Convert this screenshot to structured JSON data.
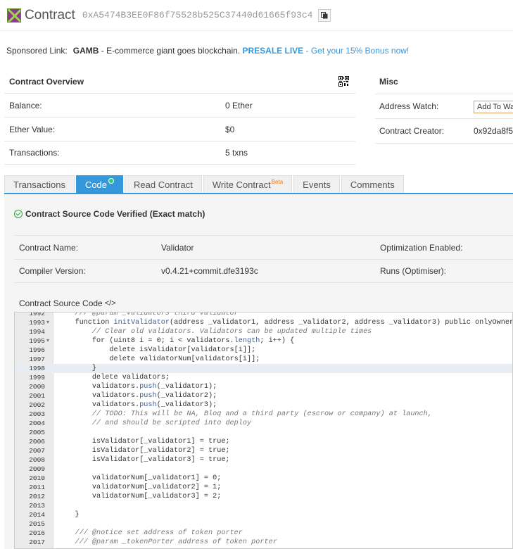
{
  "header": {
    "title": "Contract",
    "address": "0xA5474B3EE0F86f75528b525C37440d61665f93c4"
  },
  "sponsor": {
    "label": "Sponsored Link:",
    "brand": "GAMB",
    "text": " - E-commerce giant goes blockchain. ",
    "presale": "PRESALE LIVE",
    "bonus": " - Get your 15% Bonus now!"
  },
  "overview": {
    "title": "Contract Overview",
    "rows": [
      {
        "key": "Balance:",
        "value": "0 Ether"
      },
      {
        "key": "Ether Value:",
        "value": "$0"
      },
      {
        "key": "Transactions:",
        "value": "5 txns"
      }
    ]
  },
  "misc": {
    "title": "Misc",
    "watch_label": "Address Watch:",
    "watch_button": "Add To Watch",
    "creator_label": "Contract Creator:",
    "creator_value": "0x92da8f5"
  },
  "tabs": [
    {
      "label": "Transactions"
    },
    {
      "label": "Code"
    },
    {
      "label": "Read Contract"
    },
    {
      "label": "Write Contract",
      "sup": "Beta"
    },
    {
      "label": "Events"
    },
    {
      "label": "Comments"
    }
  ],
  "code_section": {
    "verified": "Contract Source Code Verified (Exact match)",
    "contract_name_label": "Contract Name:",
    "contract_name": "Validator",
    "compiler_label": "Compiler Version:",
    "compiler": "v0.4.21+commit.dfe3193c",
    "optimization_label": "Optimization Enabled:",
    "runs_label": "Runs (Optimiser):",
    "source_title": "Contract Source Code",
    "source_tag": "</>"
  },
  "code_lines": [
    {
      "n": "1992",
      "t": "    /// @param _validators third validator"
    },
    {
      "n": "1993",
      "t": "    function initValidator(address _validator1, address _validator2, address _validator3) public onlyOwner {",
      "fold": true
    },
    {
      "n": "1994",
      "t": "        // Clear old validators. Validators can be updated multiple times"
    },
    {
      "n": "1995",
      "t": "        for (uint8 i = 0; i < validators.length; i++) {",
      "fold": true
    },
    {
      "n": "1996",
      "t": "            delete isValidator[validators[i]];"
    },
    {
      "n": "1997",
      "t": "            delete validatorNum[validators[i]];"
    },
    {
      "n": "1998",
      "t": "        }",
      "hl": true
    },
    {
      "n": "1999",
      "t": "        delete validators;"
    },
    {
      "n": "2000",
      "t": "        validators.push(_validator1);"
    },
    {
      "n": "2001",
      "t": "        validators.push(_validator2);"
    },
    {
      "n": "2002",
      "t": "        validators.push(_validator3);"
    },
    {
      "n": "2003",
      "t": "        // TODO: This will be NA, Bloq and a third party (escrow or company) at launch,"
    },
    {
      "n": "2004",
      "t": "        // and should be scripted into deploy"
    },
    {
      "n": "2005",
      "t": ""
    },
    {
      "n": "2006",
      "t": "        isValidator[_validator1] = true;"
    },
    {
      "n": "2007",
      "t": "        isValidator[_validator2] = true;"
    },
    {
      "n": "2008",
      "t": "        isValidator[_validator3] = true;"
    },
    {
      "n": "2009",
      "t": ""
    },
    {
      "n": "2010",
      "t": "        validatorNum[_validator1] = 0;"
    },
    {
      "n": "2011",
      "t": "        validatorNum[_validator2] = 1;"
    },
    {
      "n": "2012",
      "t": "        validatorNum[_validator3] = 2;"
    },
    {
      "n": "2013",
      "t": ""
    },
    {
      "n": "2014",
      "t": "    }"
    },
    {
      "n": "2015",
      "t": ""
    },
    {
      "n": "2016",
      "t": "    /// @notice set address of token porter"
    },
    {
      "n": "2017",
      "t": "    /// @param _tokenPorter address of token porter"
    }
  ]
}
